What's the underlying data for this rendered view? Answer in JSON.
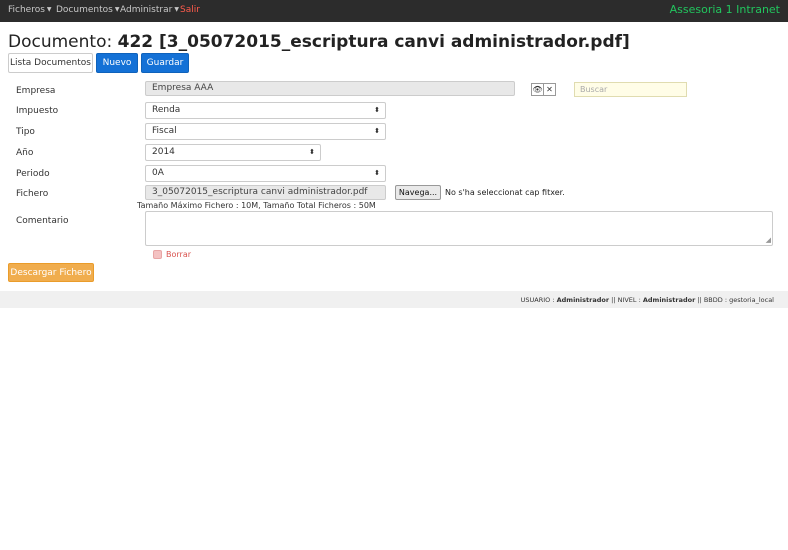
{
  "nav": {
    "items": [
      {
        "label": "Ficheros"
      },
      {
        "label": "Documentos"
      },
      {
        "label": "Administrar"
      }
    ],
    "logout": "Salir",
    "brand": "Assesoria 1 Intranet"
  },
  "header": {
    "title_prefix": "Documento:",
    "title_main": "422 [3_05072015_escriptura canvi administrador.pdf]"
  },
  "toolbar": {
    "list_label": "Lista Documentos",
    "new_label": "Nuevo",
    "save_label": "Guardar"
  },
  "form": {
    "empresa": {
      "label": "Empresa",
      "value": "Empresa AAA"
    },
    "search": {
      "placeholder": "Buscar"
    },
    "impuesto": {
      "label": "Impuesto",
      "value": "Renda"
    },
    "tipo": {
      "label": "Tipo",
      "value": "Fiscal"
    },
    "anio": {
      "label": "Año",
      "value": "2014"
    },
    "periodo": {
      "label": "Periodo",
      "value": "0A"
    },
    "fichero": {
      "label": "Fichero",
      "value": "3_05072015_escriptura canvi administrador.pdf",
      "browse_label": "Navega...",
      "status": "No s'ha seleccionat cap fitxer.",
      "size_note": "Tamaño Máximo Fichero : 10M, Tamaño Total Ficheros : 50M"
    },
    "comentario": {
      "label": "Comentario",
      "value": ""
    },
    "delete_label": "Borrar",
    "download_label": "Descargar Fichero"
  },
  "footer": {
    "user_key": "USUARIO :",
    "user_value": "Administrador",
    "level_key": "|| NIVEL :",
    "level_value": "Administrador",
    "db_key": "|| BBDD :",
    "db_value": "gestoria_local"
  },
  "colors": {
    "navbar": "#2c2c2c",
    "brand": "#22c55e",
    "primary": "#1471d6",
    "warning": "#f0ad4e",
    "danger": "#d9534f"
  }
}
